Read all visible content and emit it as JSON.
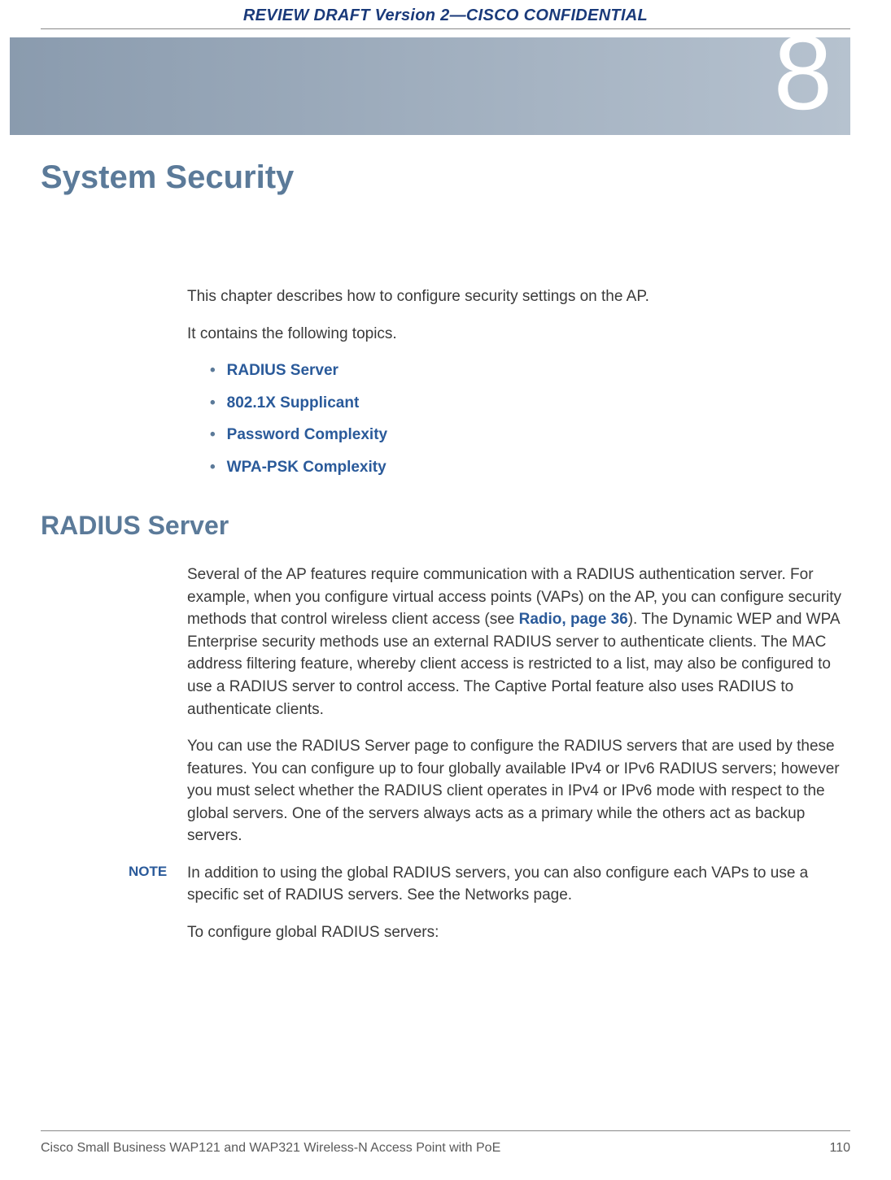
{
  "draft_header": "REVIEW DRAFT  Version 2—CISCO CONFIDENTIAL",
  "chapter_number": "8",
  "chapter_title": "System Security",
  "intro": {
    "p1": "This chapter describes how to configure security settings on the AP.",
    "p2": "It contains the following topics."
  },
  "topics": {
    "t1": "RADIUS Server",
    "t2": "802.1X Supplicant",
    "t3": "Password Complexity",
    "t4": "WPA-PSK Complexity"
  },
  "section1": {
    "heading": "RADIUS Server",
    "p1_a": "Several of the AP features require communication with a RADIUS authentication server. For example, when you configure virtual access points (VAPs) on the AP, you can configure security methods that control wireless client access (see ",
    "p1_link": "Radio, page 36",
    "p1_b": "). The Dynamic WEP and WPA Enterprise security methods use an external RADIUS server to authenticate clients. The MAC address filtering feature, whereby client access is restricted to a list, may also be configured to use a RADIUS server to control access. The Captive Portal feature also uses RADIUS to authenticate clients.",
    "p2": "You can use the RADIUS Server page to configure the RADIUS servers that are used by these features. You can configure up to four globally available IPv4 or IPv6 RADIUS servers; however you must select whether the RADIUS client operates in IPv4 or IPv6 mode with respect to the global servers. One of the servers always acts as a primary while the others act as backup servers.",
    "note_label": "NOTE",
    "note_text": "In addition to using the global RADIUS servers, you can also configure each VAPs to use a specific set of RADIUS servers. See the Networks page.",
    "p3": "To configure global RADIUS servers:"
  },
  "footer": {
    "left": "Cisco Small Business WAP121 and WAP321 Wireless-N Access Point with PoE",
    "right": "110"
  }
}
